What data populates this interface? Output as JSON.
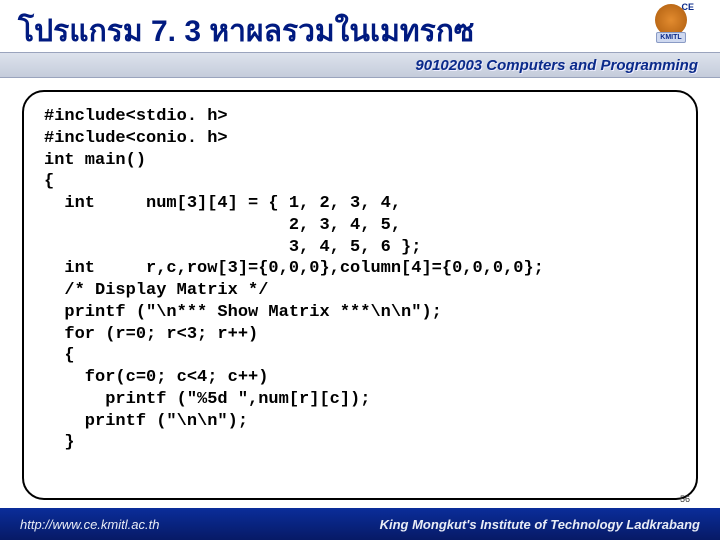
{
  "header": {
    "title": "โปรแกรม  7. 3 หาผลรวมในเมทรกซ",
    "logo_badge": "KMITL",
    "logo_ce": "CE"
  },
  "sub_header": {
    "course": "90102003 Computers and Programming"
  },
  "code": {
    "lines": "#include<stdio. h>\n#include<conio. h>\nint main()\n{\n  int     num[3][4] = { 1, 2, 3, 4,\n                        2, 3, 4, 5,\n                        3, 4, 5, 6 };\n  int     r,c,row[3]={0,0,0},column[4]={0,0,0,0};\n  /* Display Matrix */\n  printf (\"\\n*** Show Matrix ***\\n\\n\");\n  for (r=0; r<3; r++)\n  {\n    for(c=0; c<4; c++)\n      printf (\"%5d \",num[r][c]);\n    printf (\"\\n\\n\");\n  }"
  },
  "page_number": "56",
  "footer": {
    "url": "http://www.ce.kmitl.ac.th",
    "institution": "King Mongkut's Institute of Technology Ladkrabang"
  }
}
